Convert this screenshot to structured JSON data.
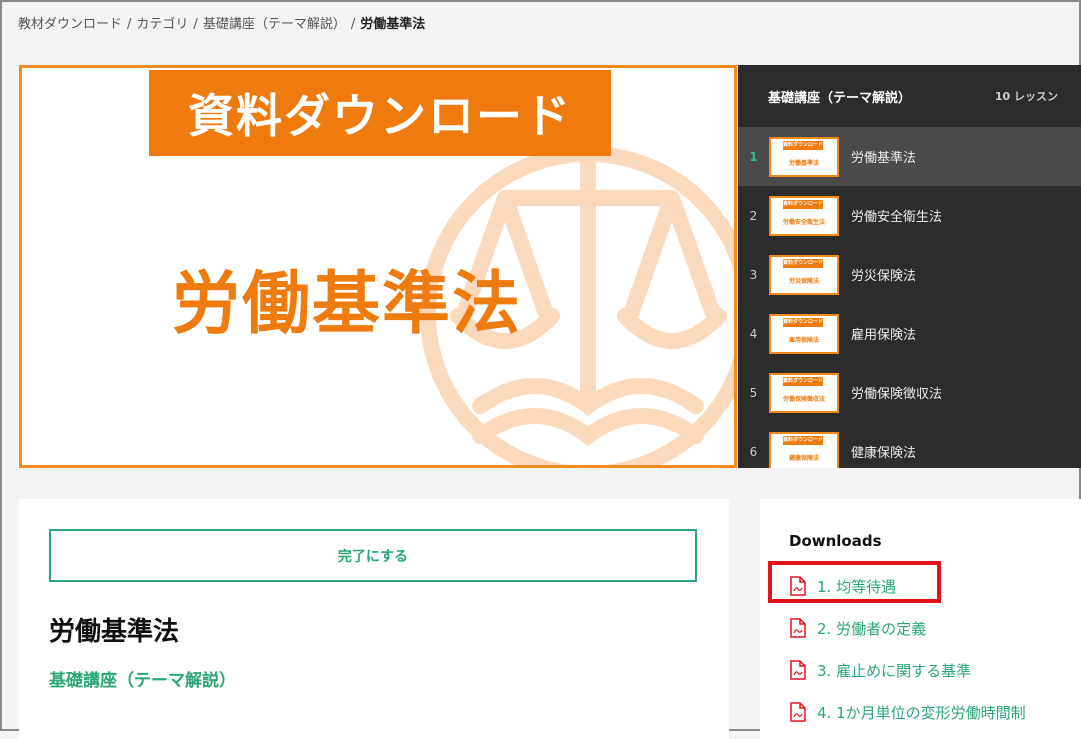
{
  "breadcrumb": {
    "items": [
      "教材ダウンロード",
      "カテゴリ",
      "基礎講座（テーマ解説）"
    ],
    "current": "労働基準法",
    "separator": "/"
  },
  "hero": {
    "banner": "資料ダウンロード",
    "headline": "労働基準法"
  },
  "playlist": {
    "title": "基礎講座（テーマ解説）",
    "count": "10 レッスン",
    "items": [
      {
        "num": "1",
        "label": "労働基準法",
        "thumb_banner": "資料ダウンロード",
        "thumb_title": "労働基準法"
      },
      {
        "num": "2",
        "label": "労働安全衛生法",
        "thumb_banner": "資料ダウンロード",
        "thumb_title": "労働安全衛生法"
      },
      {
        "num": "3",
        "label": "労災保険法",
        "thumb_banner": "資料ダウンロード",
        "thumb_title": "労災保険法"
      },
      {
        "num": "4",
        "label": "雇用保険法",
        "thumb_banner": "資料ダウンロード",
        "thumb_title": "雇用保険法"
      },
      {
        "num": "5",
        "label": "労働保険徴収法",
        "thumb_banner": "資料ダウンロード",
        "thumb_title": "労働保険徴収法"
      },
      {
        "num": "6",
        "label": "健康保険法",
        "thumb_banner": "資料ダウンロード",
        "thumb_title": "健康保険法"
      }
    ]
  },
  "lesson": {
    "complete_label": "完了にする",
    "title": "労働基準法",
    "course": "基礎講座（テーマ解説）"
  },
  "downloads": {
    "heading": "Downloads",
    "items": [
      "1. 均等待遇",
      "2. 労働者の定義",
      "3. 雇止めに関する基準",
      "4. 1か月単位の変形労働時間制"
    ]
  },
  "colors": {
    "accent_orange": "#ef7a0d",
    "accent_green": "#2aa777",
    "highlight_red": "#e3131b",
    "sidebar_dark": "#2c2c2c"
  }
}
